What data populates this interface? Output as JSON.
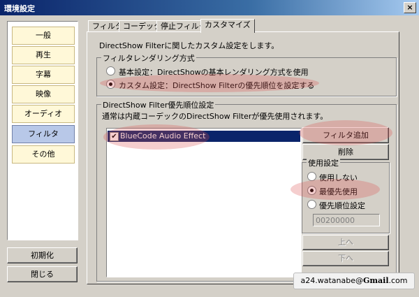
{
  "window": {
    "title": "環境設定",
    "close_glyph": "×"
  },
  "sidebar": {
    "items": [
      {
        "label": "一般"
      },
      {
        "label": "再生"
      },
      {
        "label": "字幕"
      },
      {
        "label": "映像"
      },
      {
        "label": "オーディオ"
      },
      {
        "label": "フィルタ",
        "selected": true
      },
      {
        "label": "その他"
      }
    ],
    "reset_label": "初期化",
    "close_label": "閉じる"
  },
  "tabs": [
    {
      "label": "フィルタ"
    },
    {
      "label": "コーデック"
    },
    {
      "label": "停止フィルタ"
    },
    {
      "label": "カスタマイズ",
      "active": true
    }
  ],
  "main": {
    "description": "DirectShow Filterに関したカスタム設定をします。",
    "rendering_group": {
      "title": "フィルタレンダリング方式",
      "options": [
        {
          "label": "基本設定：DirectShowの基本レンダリング方式を使用",
          "selected": false
        },
        {
          "label": "カスタム設定：DirectShow Filterの優先順位を設定する",
          "selected": true
        }
      ]
    },
    "priority_group": {
      "title": "DirectShow Filter優先順位設定",
      "note": "通常は内蔵コーデックのDirectShow Filterが優先使用されます。",
      "filters": [
        {
          "name": "BlueCode Audio Effect",
          "checked": true,
          "selected": true
        }
      ],
      "check_glyph": "✔",
      "add_filter_label": "フィルタ追加",
      "delete_label": "削除",
      "usage_group": {
        "title": "使用設定",
        "options": [
          {
            "label": "使用しない",
            "selected": false
          },
          {
            "label": "最優先使用",
            "selected": true
          },
          {
            "label": "優先順位設定",
            "selected": false
          }
        ],
        "priority_value": "00200000"
      },
      "up_label": "上へ",
      "down_label": "下へ"
    }
  },
  "watermark": {
    "prefix": "a24.watanabe",
    "at": "@",
    "brand": "Gmail",
    "suffix": ".com"
  },
  "colors": {
    "accent": "#0a246a",
    "highlight": "#dc5050",
    "sidebar_item": "#fff8d8",
    "sidebar_selected": "#b8c8e8"
  }
}
